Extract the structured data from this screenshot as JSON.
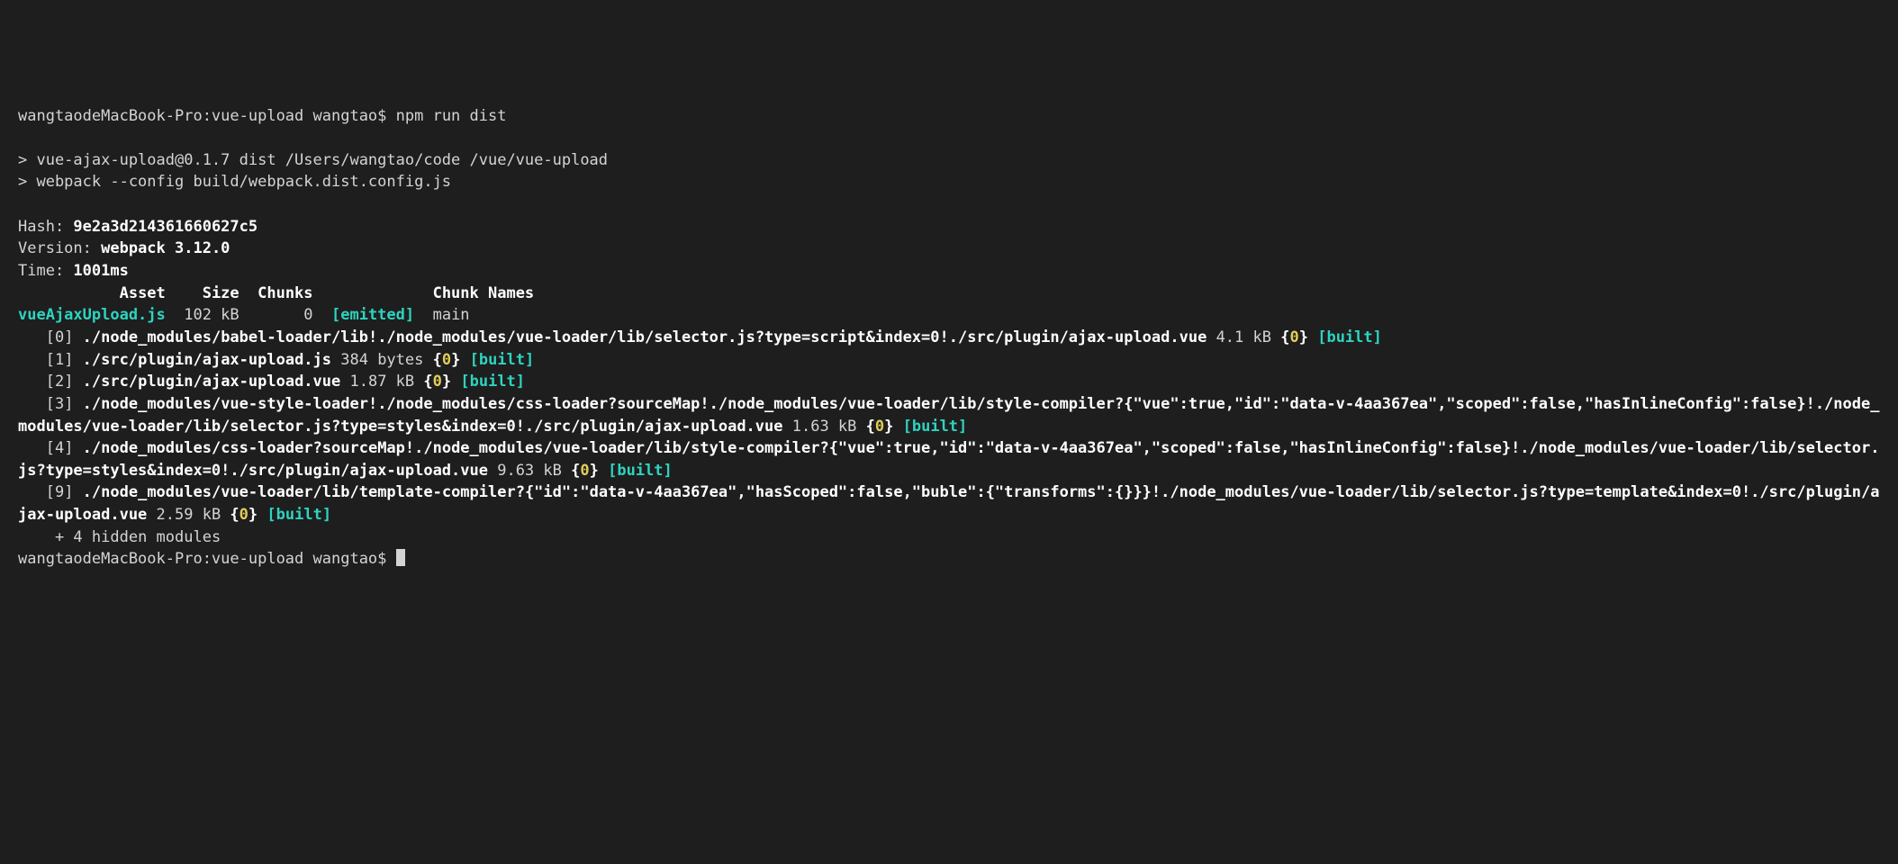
{
  "prompt1_prefix": "wangtaodeMacBook-Pro:vue-upload wangtao$ ",
  "command": "npm run dist",
  "script_line1": "> vue-ajax-upload@0.1.7 dist /Users/wangtao/code /vue/vue-upload",
  "script_line2": "> webpack --config build/webpack.dist.config.js",
  "hash_label": "Hash: ",
  "hash_value": "9e2a3d214361660627c5",
  "version_label": "Version: ",
  "version_value": "webpack 3.12.0",
  "time_label": "Time: ",
  "time_value": "1001ms",
  "header_row": "           Asset    Size  Chunks             Chunk Names",
  "asset_name": "vueAjaxUpload.js",
  "asset_rest": "  102 kB       0  ",
  "emitted": "[emitted]",
  "asset_chunkname": "  main",
  "m0_prefix": "   [0] ",
  "m0_path_a": "./node_modules/babel-loader/lib!./node_modules/vue-loader/lib/selector.js?type=script&index=0!./src/plugin/ajax-upload.vue",
  "m0_size": " 4.1 kB ",
  "chunk_open": "{",
  "chunk_num": "0",
  "chunk_close": "}",
  "built": "[built]",
  "m1_prefix": "   [1] ",
  "m1_path": "./src/plugin/ajax-upload.js",
  "m1_size": " 384 bytes ",
  "m2_prefix": "   [2] ",
  "m2_path": "./src/plugin/ajax-upload.vue",
  "m2_size": " 1.87 kB ",
  "m3_prefix": "   [3] ",
  "m3_path": "./node_modules/vue-style-loader!./node_modules/css-loader?sourceMap!./node_modules/vue-loader/lib/style-compiler?{\"vue\":true,\"id\":\"data-v-4aa367ea\",\"scoped\":false,\"hasInlineConfig\":false}!./node_modules/vue-loader/lib/selector.js?type=styles&index=0!./src/plugin/ajax-upload.vue",
  "m3_size": " 1.63 kB ",
  "m4_prefix": "   [4] ",
  "m4_path": "./node_modules/css-loader?sourceMap!./node_modules/vue-loader/lib/style-compiler?{\"vue\":true,\"id\":\"data-v-4aa367ea\",\"scoped\":false,\"hasInlineConfig\":false}!./node_modules/vue-loader/lib/selector.js?type=styles&index=0!./src/plugin/ajax-upload.vue",
  "m4_size": " 9.63 kB ",
  "m9_prefix": "   [9] ",
  "m9_path": "./node_modules/vue-loader/lib/template-compiler?{\"id\":\"data-v-4aa367ea\",\"hasScoped\":false,\"buble\":{\"transforms\":{}}}!./node_modules/vue-loader/lib/selector.js?type=template&index=0!./src/plugin/ajax-upload.vue",
  "m9_size": " 2.59 kB ",
  "hidden": "    + 4 hidden modules",
  "prompt2_prefix": "wangtaodeMacBook-Pro:vue-upload wangtao$ "
}
